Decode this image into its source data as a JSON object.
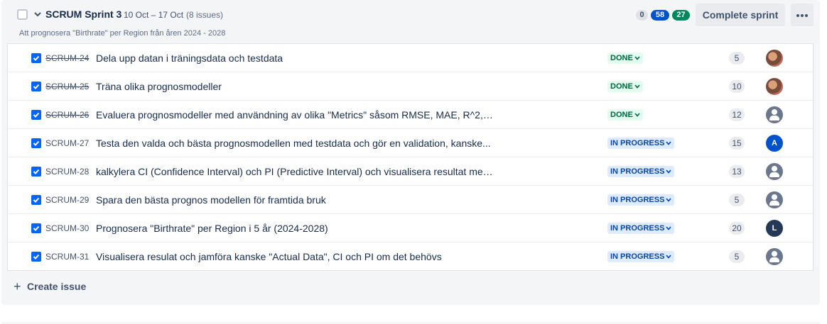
{
  "sprint": {
    "name": "SCRUM Sprint 3",
    "dates": "10 Oct – 17 Oct",
    "issue_count": "(8 issues)",
    "goal": "Att prognosera \"Birthrate\" per Region från åren 2024 - 2028",
    "counts": {
      "todo": "0",
      "in_progress": "58",
      "done": "27"
    },
    "complete_label": "Complete sprint",
    "create_label": "Create issue"
  },
  "issues": [
    {
      "key": "SCRUM-24",
      "summary": "Dela upp datan i träningsdata och testdata",
      "status": "DONE",
      "points": "5",
      "assignee": "photo"
    },
    {
      "key": "SCRUM-25",
      "summary": "Träna olika prognosmodeller",
      "status": "DONE",
      "points": "10",
      "assignee": "photo"
    },
    {
      "key": "SCRUM-26",
      "summary": "Evaluera prognosmodeller med användning av olika \"Metrics\" såsom RMSE, MAE, R^2, ...",
      "status": "DONE",
      "points": "12",
      "assignee": "unassigned"
    },
    {
      "key": "SCRUM-27",
      "summary": "Testa den valda och bästa prognosmodellen med testdata och gör en validation, kanske...",
      "status": "IN PROGRESS",
      "points": "15",
      "assignee": "A"
    },
    {
      "key": "SCRUM-28",
      "summary": "kalkylera CI (Confidence Interval) och PI (Predictive Interval) och visualisera resultat med...",
      "status": "IN PROGRESS",
      "points": "13",
      "assignee": "unassigned"
    },
    {
      "key": "SCRUM-29",
      "summary": "Spara den bästa prognos modellen för framtida bruk",
      "status": "IN PROGRESS",
      "points": "5",
      "assignee": "unassigned"
    },
    {
      "key": "SCRUM-30",
      "summary": "Prognosera \"Birthrate\" per Region i 5 år (2024-2028)",
      "status": "IN PROGRESS",
      "points": "20",
      "assignee": "L"
    },
    {
      "key": "SCRUM-31",
      "summary": "Visualisera resulat och jamföra kanske \"Actual Data\", CI och PI om det behövs",
      "status": "IN PROGRESS",
      "points": "5",
      "assignee": "unassigned"
    }
  ],
  "colors": {
    "done": "#006644",
    "in_progress": "#0747a6",
    "brand": "#0052cc"
  },
  "icons": {
    "chevron": "chevron-down-icon",
    "more": "more-icon",
    "plus": "plus-icon",
    "check": "checkbox-icon"
  }
}
